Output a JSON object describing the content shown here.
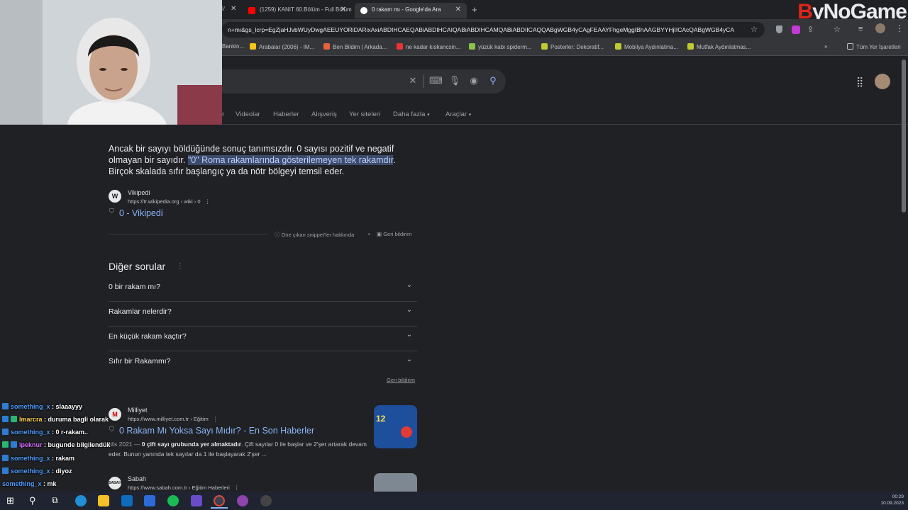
{
  "tabs": [
    {
      "label": "(1259) KANIT 60.Bölüm - Full Bölüm",
      "favicon": "youtube-icon"
    },
    {
      "label": "0 rakam mı - Google'da Ara",
      "favicon": "google-icon",
      "active": true
    }
  ],
  "omnibox": {
    "url": "n+mı&gs_lcrp=EgZjaHJvbWUyDwgAEEUYORiDARixAxiABDIHCAEQABiABDIHCAIQABiABDIHCAMQABiABDIICAQQABgWGB4yCAgFEAAYFhgeMggIBhAAGBYYHjIICAcQABgWGB4yCA"
  },
  "bookmarks": [
    "Bankin...",
    "Arabalar (2006) - IM...",
    "Ben Bildim | Arkada...",
    "ne kadar kıskancsin...",
    "yüzük kabı spiderm...",
    "Posterler: Dekoratif...",
    "Mobilya Aydınlatma...",
    "Mutfak Aydınlatmas..."
  ],
  "bookmarks_all": "Tüm Yer İşaretleri",
  "brand_logo": {
    "prefix": "B",
    "rest": "yNoGame"
  },
  "nav_tabs": [
    "r",
    "Videolar",
    "Haberler",
    "Alışveriş",
    "Yer siteleri",
    "Daha fazla",
    "Araçlar"
  ],
  "snippet": {
    "part1": "Ancak bir sayıyı böldüğünde sonuç tanımsızdır. 0 sayısı pozitif ve negatif olmayan bir sayıdır. ",
    "highlight": "\"0\" Roma rakamlarında gösterilemeyen tek rakamdır",
    "part2": ". Birçok skalada sıfır başlangıç ya da nötr bölgeyi temsil eder."
  },
  "wiki": {
    "site": "Vikipedi",
    "url": "https://tr.wikipedia.org › wiki › 0",
    "title": "0 - Vikipedi",
    "favicon": "W"
  },
  "snippet_footer": {
    "about": "Öne çıkan snippet'ler hakkında",
    "feedback": "Geri bildirim"
  },
  "other_questions": {
    "title": "Diğer sorular",
    "items": [
      "0 bir rakam mı?",
      "Rakamlar nelerdir?",
      "En küçük rakam kaçtır?",
      "Sıfır bir Rakammı?"
    ],
    "feedback": "Geri bildirim"
  },
  "result_milliyet": {
    "site": "Milliyet",
    "url": "https://www.milliyet.com.tr › Eğitim",
    "title": "0 Rakam Mı Yoksa Sayı Mıdır? - En Son Haberler",
    "date": "Nis 2021 — ",
    "bold": "0 çift sayı grubunda yer almaktadır",
    "desc": ". Çift sayılar 0 ile başlar ve 2'şer artarak devam eder. Bunun yanında tek sayılar da 1 ile başlayarak 2'şer ...",
    "thumb_text": "12"
  },
  "result_sabah": {
    "site": "Sabah",
    "url": "https://www.sabah.com.tr › Eğitim Haberleri",
    "favicon": "SABAH"
  },
  "chat": [
    {
      "user": "something_x",
      "msg": "slaaayyy",
      "color": "#4d9eff"
    },
    {
      "user": "lmarcra",
      "msg": "duruma bagli olarak",
      "color": "#ffd24d"
    },
    {
      "user": "something_x",
      "msg": "0 r-rakam..",
      "color": "#4d9eff"
    },
    {
      "user": "ipeknur",
      "msg": "bugunde bilgilendük",
      "color": "#d36bff"
    },
    {
      "user": "something_x",
      "msg": "rakam",
      "color": "#4d9eff"
    },
    {
      "user": "something_x",
      "msg": "diyoz",
      "color": "#4d9eff"
    },
    {
      "user": "something_x",
      "msg": "mk",
      "color": "#4d9eff"
    }
  ],
  "clock": {
    "time": "00:29",
    "date": "10.09.2023"
  }
}
